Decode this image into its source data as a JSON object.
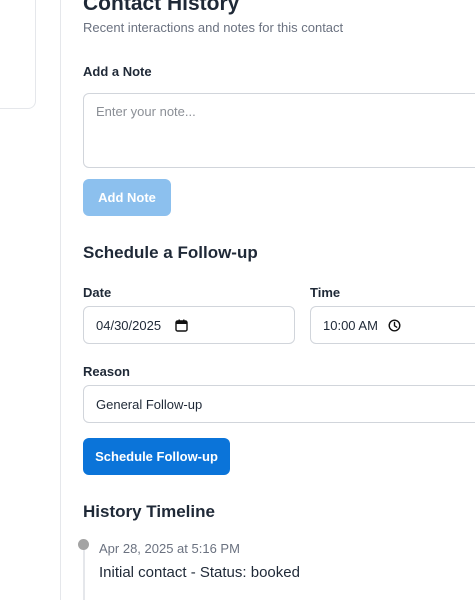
{
  "history": {
    "title": "Contact History",
    "subtitle": "Recent interactions and notes for this contact"
  },
  "add_note": {
    "label": "Add a Note",
    "placeholder": "Enter your note...",
    "button_label": "Add Note"
  },
  "follow_up": {
    "heading": "Schedule a Follow-up",
    "date_label": "Date",
    "date_value": "04/30/2025",
    "time_label": "Time",
    "time_value": "10:00 AM",
    "reason_label": "Reason",
    "reason_value": "General Follow-up",
    "button_label": "Schedule Follow-up"
  },
  "timeline": {
    "heading": "History Timeline",
    "entries": [
      {
        "timestamp": "Apr 28, 2025 at 5:16 PM",
        "text": "Initial contact - Status: booked"
      }
    ]
  },
  "icons": {
    "date": "calendar-icon",
    "time": "clock-icon"
  },
  "colors": {
    "primary": "#0b74d9",
    "primary_disabled": "#8cc0ee",
    "border": "#d1d5db",
    "muted_text": "#6b7280"
  }
}
